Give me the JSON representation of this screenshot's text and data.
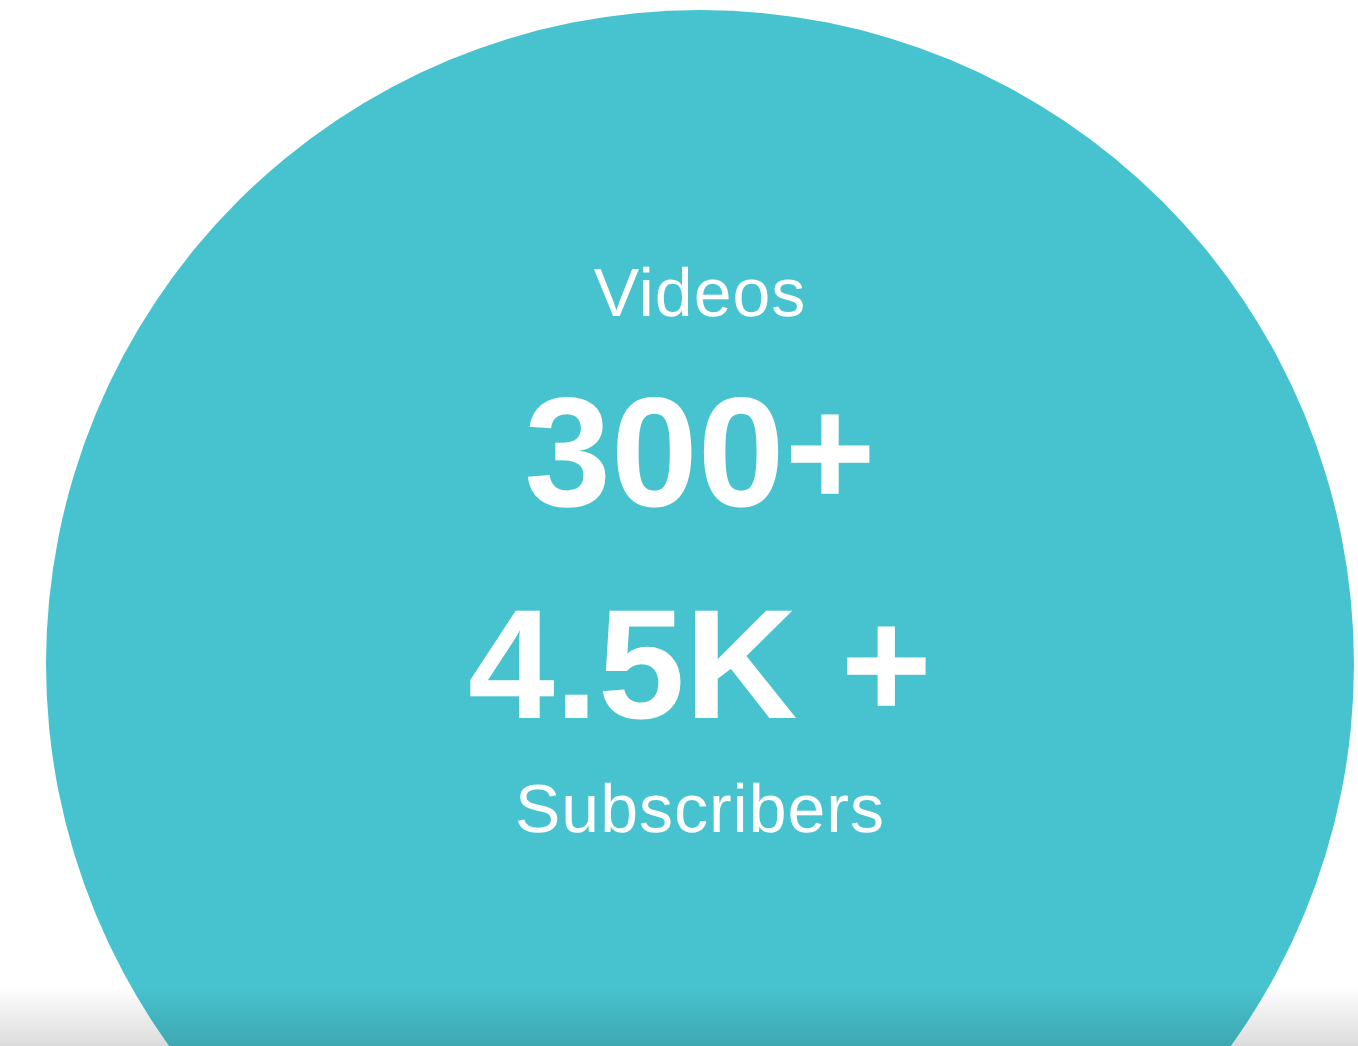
{
  "videos": {
    "label": "Videos",
    "value": "300+"
  },
  "subscribers": {
    "value": "4.5K +",
    "label": "Subscribers"
  }
}
